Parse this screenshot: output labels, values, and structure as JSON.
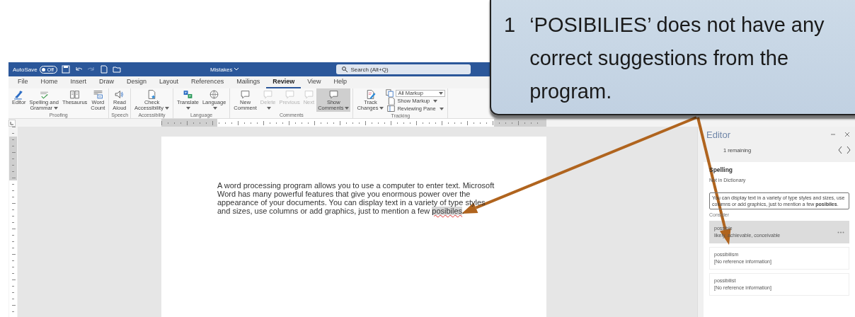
{
  "title_bar": {
    "autosave_label": "AutoSave",
    "autosave_state": "Off",
    "autosave_on": false,
    "document_title": "Mistakes",
    "search_placeholder": "Search (Alt+Q)"
  },
  "menu_tabs": [
    {
      "label": "File",
      "selected": false
    },
    {
      "label": "Home",
      "selected": false
    },
    {
      "label": "Insert",
      "selected": false
    },
    {
      "label": "Draw",
      "selected": false
    },
    {
      "label": "Design",
      "selected": false
    },
    {
      "label": "Layout",
      "selected": false
    },
    {
      "label": "References",
      "selected": false
    },
    {
      "label": "Mailings",
      "selected": false
    },
    {
      "label": "Review",
      "selected": true
    },
    {
      "label": "View",
      "selected": false
    },
    {
      "label": "Help",
      "selected": false
    }
  ],
  "ribbon_groups": [
    {
      "name": "Proofing",
      "buttons": [
        {
          "kind": "large",
          "label": "Editor",
          "dropdown": false,
          "disabled": false,
          "selected": false
        },
        {
          "kind": "large",
          "label": "Spelling and\nGrammar",
          "dropdown": true,
          "disabled": false,
          "selected": false
        },
        {
          "kind": "large",
          "label": "Thesaurus",
          "dropdown": false,
          "disabled": false,
          "selected": false
        },
        {
          "kind": "large",
          "label": "Word\nCount",
          "dropdown": false,
          "disabled": false,
          "selected": false
        }
      ]
    },
    {
      "name": "Speech",
      "buttons": [
        {
          "kind": "large",
          "label": "Read\nAloud",
          "dropdown": false,
          "disabled": false,
          "selected": false
        }
      ]
    },
    {
      "name": "Accessibility",
      "buttons": [
        {
          "kind": "large",
          "label": "Check\nAccessibility",
          "dropdown": true,
          "disabled": false,
          "selected": false
        }
      ]
    },
    {
      "name": "Language",
      "buttons": [
        {
          "kind": "large",
          "label": "Translate\n",
          "dropdown": true,
          "disabled": false,
          "selected": false
        },
        {
          "kind": "large",
          "label": "Language\n",
          "dropdown": true,
          "disabled": false,
          "selected": false
        }
      ]
    },
    {
      "name": "Comments",
      "buttons": [
        {
          "kind": "large",
          "label": "New\nComment",
          "dropdown": false,
          "disabled": false,
          "selected": false
        },
        {
          "kind": "large",
          "label": "Delete\n",
          "dropdown": true,
          "disabled": true,
          "selected": false
        },
        {
          "kind": "large",
          "label": "Previous",
          "dropdown": false,
          "disabled": true,
          "selected": false
        },
        {
          "kind": "large",
          "label": "Next",
          "dropdown": false,
          "disabled": true,
          "selected": false
        },
        {
          "kind": "large",
          "label": "Show\nComments",
          "dropdown": true,
          "disabled": false,
          "selected": true
        }
      ]
    },
    {
      "name": "Tracking",
      "buttons": [
        {
          "kind": "large",
          "label": "Track\nChanges",
          "dropdown": true,
          "disabled": false,
          "selected": false
        },
        {
          "kind": "combo",
          "label": "All Markup",
          "dropdown": true,
          "disabled": false,
          "selected": false
        },
        {
          "kind": "small",
          "label": "Show Markup",
          "dropdown": true,
          "disabled": false,
          "selected": false
        },
        {
          "kind": "small",
          "label": "Reviewing Pane",
          "dropdown": true,
          "disabled": false,
          "selected": false
        }
      ]
    }
  ],
  "document": {
    "paragraph": "A word processing program allows you to use a computer to enter text.  Microsoft Word has many powerful features that give you enormous power over the appearance of your documents.  You can display text in a variety of type styles and sizes, use columns or add graphics, just to mention a few *posibiles*."
  },
  "editor_pane": {
    "title": "Editor",
    "remaining": "1 remaining",
    "section": "Spelling",
    "subtitle": "Not in Dictionary",
    "context": "You can display text in a variety of type styles and sizes, use columns or add graphics, just to mention a few **posibiles**.",
    "consider_label": "Consider",
    "suggestions": [
      {
        "word": "possible",
        "detail": "likely, achievable, conceivable",
        "selected": true
      },
      {
        "word": "possibilism",
        "detail": "[No reference information]",
        "selected": false
      },
      {
        "word": "possibilist",
        "detail": "[No reference information]",
        "selected": false
      }
    ]
  },
  "callout": {
    "number": "1",
    "text": "‘POSIBILIES’ does not have any correct suggestions from the program."
  }
}
